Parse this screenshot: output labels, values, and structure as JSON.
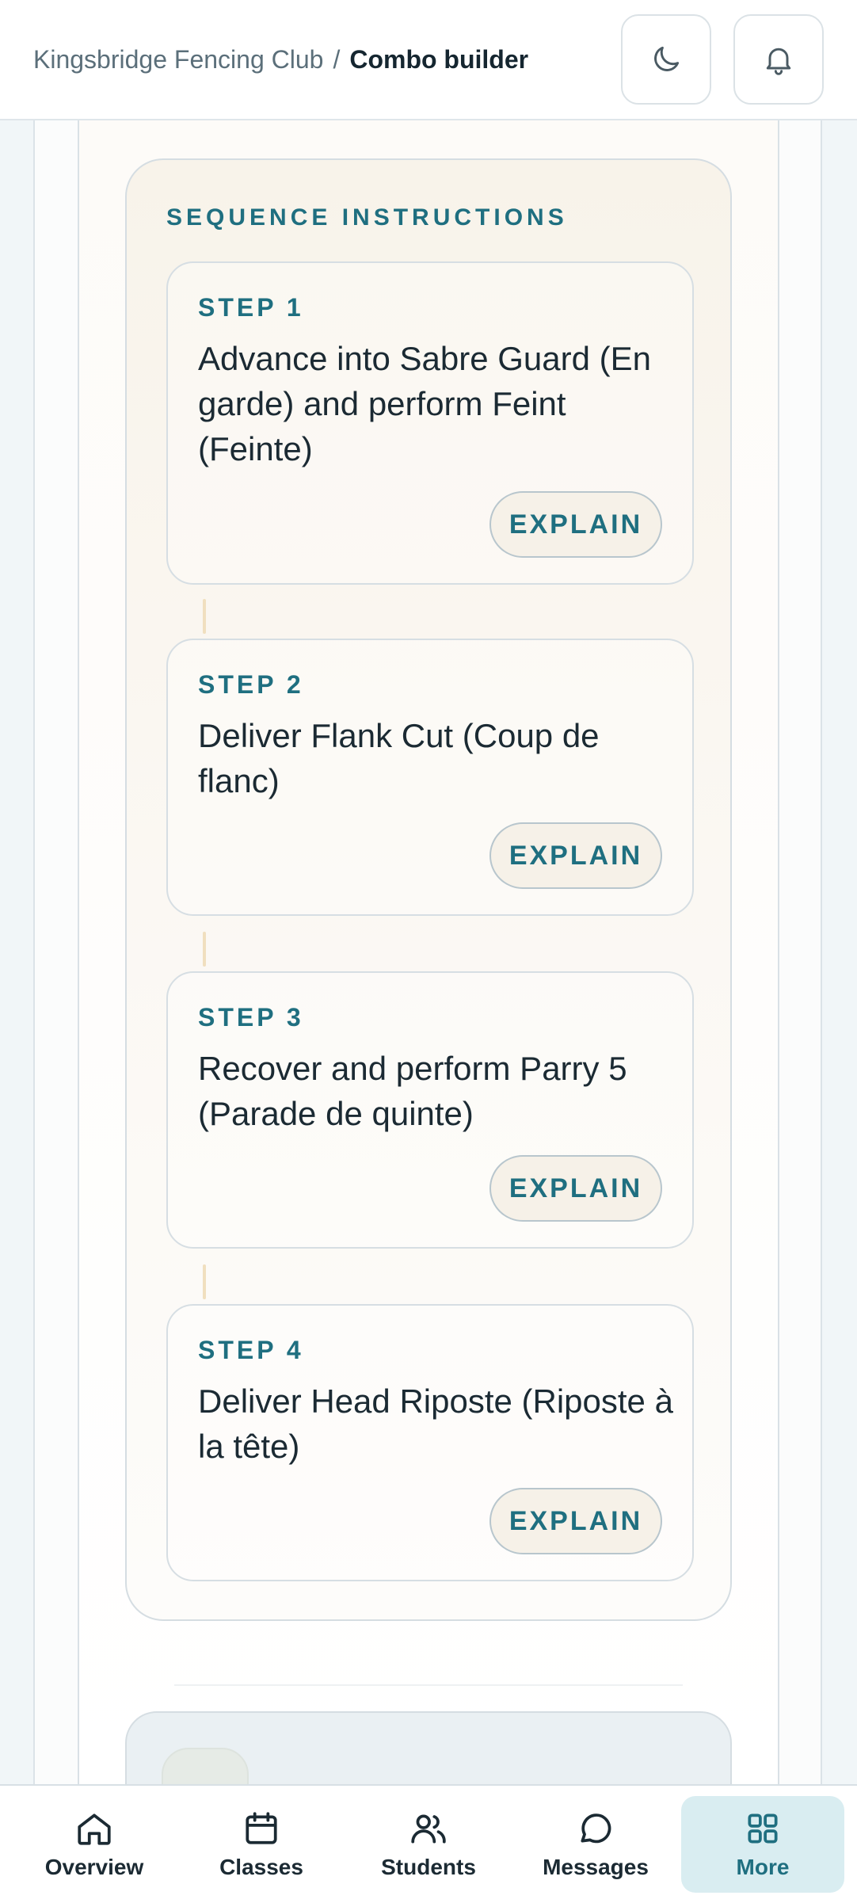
{
  "header": {
    "club_name": "Kingsbridge Fencing Club",
    "separator": "/",
    "page_title": "Combo builder",
    "theme_toggle_icon": "moon-icon",
    "notifications_icon": "bell-icon"
  },
  "sequence": {
    "title": "SEQUENCE INSTRUCTIONS",
    "steps": [
      {
        "label": "STEP 1",
        "text": "Advance into Sabre Guard (En garde) and perform Feint (Feinte)",
        "button": "EXPLAIN"
      },
      {
        "label": "STEP 2",
        "text": "Deliver Flank Cut (Coup de flanc)",
        "button": "EXPLAIN"
      },
      {
        "label": "STEP 3",
        "text": "Recover and perform Parry 5 (Parade de quinte)",
        "button": "EXPLAIN"
      },
      {
        "label": "STEP 4",
        "text": "Deliver Head Riposte (Riposte à la tête)",
        "button": "EXPLAIN"
      }
    ]
  },
  "nav": {
    "items": [
      {
        "label": "Overview",
        "icon": "home-icon"
      },
      {
        "label": "Classes",
        "icon": "calendar-icon"
      },
      {
        "label": "Students",
        "icon": "users-icon"
      },
      {
        "label": "Messages",
        "icon": "chat-icon"
      },
      {
        "label": "More",
        "icon": "grid-icon",
        "active": true
      }
    ]
  },
  "colors": {
    "accent": "#1f6f80",
    "text": "#1b2a33",
    "nav_active_bg": "#d9edf1"
  }
}
